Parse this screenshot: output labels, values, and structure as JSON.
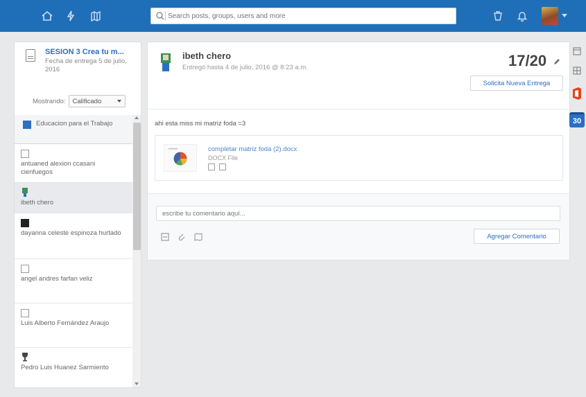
{
  "search": {
    "placeholder": "Search posts, groups, users and more"
  },
  "assignment": {
    "title": "SESION 3 Crea tu m...",
    "due": "Fecha de entrega 5 de julio, 2016"
  },
  "filter": {
    "label": "Mostrando:",
    "value": "Calificado"
  },
  "group": {
    "label": "Educacion para el Trabajo"
  },
  "students": [
    {
      "name": "antuaned alexion ccasani cienfuegos",
      "avatar": "square"
    },
    {
      "name": "ibeth chero",
      "avatar": "person"
    },
    {
      "name": "dayanna celeste espinoza hurtado",
      "avatar": "dark"
    },
    {
      "name": "angel andres farfan veliz",
      "avatar": "square"
    },
    {
      "name": "Luis Alberto Fernández Araujo",
      "avatar": "square"
    },
    {
      "name": "Pedro Luis Huanez Sarmiento",
      "avatar": "trophy"
    }
  ],
  "submission": {
    "student_name": "ibeth chero",
    "delivered": "Entregó hasta 4 de julio, 2016 @ 8:23 a.m.",
    "grade": "17/20",
    "resubmit_label": "Solicita Nueva Entrega",
    "comment": "ahi esta miss mi matriz foda =3",
    "attachment_name": "completar matriz foda (2).docx",
    "attachment_type": "DOCX File"
  },
  "comments": {
    "placeholder": "escribe tu comentario aquí...",
    "add_label": "Agregar Comentario"
  },
  "rail": {
    "calendar_day": "30"
  },
  "colors": {
    "topbar": "#1f6fb8",
    "accent": "#2a6fc1",
    "office": "#e2441d"
  }
}
